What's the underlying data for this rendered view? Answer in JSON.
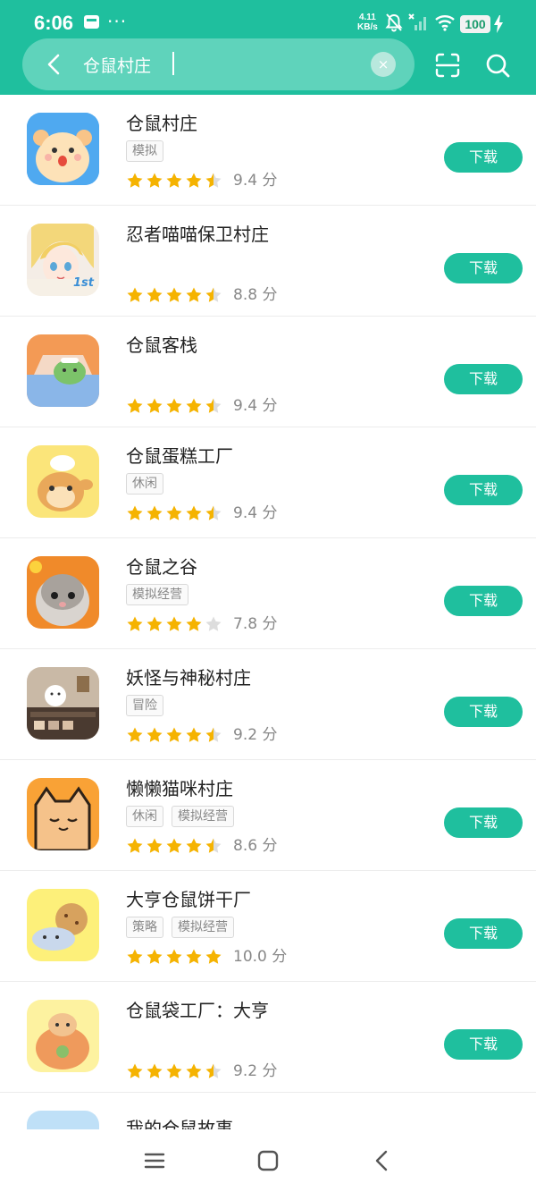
{
  "status": {
    "time": "6:06",
    "more": "···",
    "net_speed_value": "4.11",
    "net_speed_unit": "KB/s",
    "battery": "100"
  },
  "search": {
    "query": "仓鼠村庄",
    "clear_glyph": "×"
  },
  "download_label": "下载",
  "score_unit": "分",
  "colors": {
    "brand": "#1fbf9e",
    "star": "#f5b301",
    "star_empty": "#dddddd"
  },
  "apps": [
    {
      "name": "仓鼠村庄",
      "tags": [
        "模拟"
      ],
      "score": "9.4",
      "stars": 4.5,
      "icon": "hamster-village-icon"
    },
    {
      "name": "忍者喵喵保卫村庄",
      "tags": [],
      "score": "8.8",
      "stars": 4.5,
      "icon": "anime-girl-icon",
      "icon_text": "1st"
    },
    {
      "name": "仓鼠客栈",
      "tags": [],
      "score": "9.4",
      "stars": 4.5,
      "icon": "hamster-inn-icon"
    },
    {
      "name": "仓鼠蛋糕工厂",
      "tags": [
        "休闲"
      ],
      "score": "9.4",
      "stars": 4.5,
      "icon": "hamster-chef-icon"
    },
    {
      "name": "仓鼠之谷",
      "tags": [
        "模拟经营"
      ],
      "score": "7.8",
      "stars": 4,
      "icon": "hamster-valley-icon"
    },
    {
      "name": "妖怪与神秘村庄",
      "tags": [
        "冒险"
      ],
      "score": "9.2",
      "stars": 4.5,
      "icon": "lucky-cat-icon"
    },
    {
      "name": "懒懒猫咪村庄",
      "tags": [
        "休闲",
        "模拟经营"
      ],
      "score": "8.6",
      "stars": 4.5,
      "icon": "lazy-cat-icon"
    },
    {
      "name": "大亨仓鼠饼干厂",
      "tags": [
        "策略",
        "模拟经营"
      ],
      "score": "10.0",
      "stars": 5,
      "icon": "hamster-cookie-icon"
    },
    {
      "name": "仓鼠袋工厂：大亨",
      "tags": [],
      "score": "9.2",
      "stars": 4.5,
      "icon": "hamster-bag-icon"
    },
    {
      "name": "我的仓鼠故事",
      "tags": [],
      "score": "",
      "stars": 0,
      "icon": "hamster-story-icon"
    }
  ]
}
